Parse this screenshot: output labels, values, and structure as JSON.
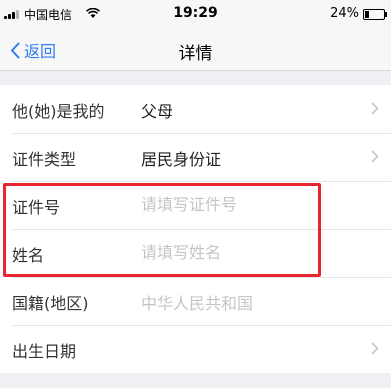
{
  "status_bar": {
    "carrier": "中国电信",
    "time": "19:29",
    "battery_percent": "24%",
    "battery_level": 0.24,
    "icons": [
      "signal-icon",
      "wifi-icon",
      "battery-icon"
    ]
  },
  "nav": {
    "back_label": "返回",
    "title": "详情",
    "accent_color": "#2f7df6"
  },
  "form": {
    "rows": [
      {
        "label": "他(她)是我的",
        "value": "父母",
        "has_chevron": true
      },
      {
        "label": "证件类型",
        "value": "居民身份证",
        "has_chevron": true
      },
      {
        "label": "证件号",
        "placeholder": "请填写证件号",
        "has_chevron": false
      },
      {
        "label": "姓名",
        "placeholder": "请填写姓名",
        "has_chevron": false
      },
      {
        "label": "国籍(地区)",
        "value": "中华人民共和国",
        "has_chevron": false
      },
      {
        "label": "出生日期",
        "value": "",
        "has_chevron": true
      }
    ]
  },
  "annotation": {
    "color": "#e8262e"
  }
}
